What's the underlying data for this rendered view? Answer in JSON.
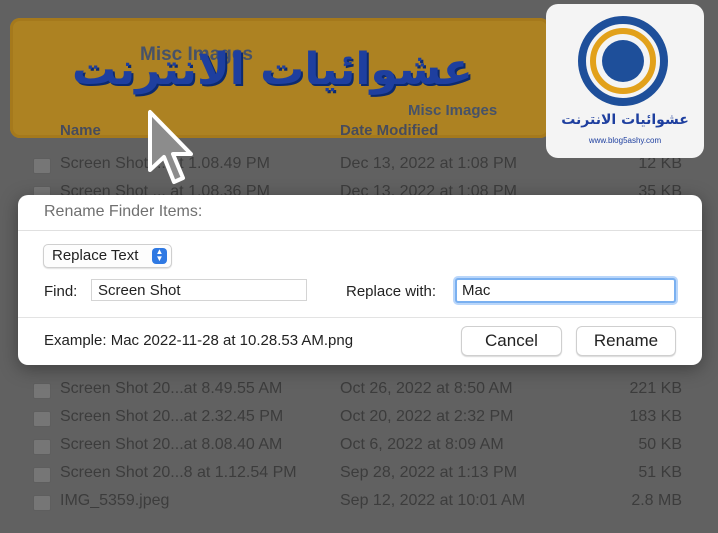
{
  "finder": {
    "folder_title": "Misc Images",
    "folder_subtitle": "Misc Images",
    "columns": {
      "name": "Name",
      "date": "Date Modified"
    },
    "rows_top": [
      {
        "name": "Screen Shot ... at 1.08.49 PM",
        "date": "Dec 13, 2022 at 1:08 PM",
        "size": "12 KB"
      },
      {
        "name": "Screen Shot ... at 1.08.36 PM",
        "date": "Dec 13, 2022 at 1:08 PM",
        "size": "35 KB"
      }
    ],
    "rows_bottom": [
      {
        "name": "Screen Shot 20...at 8.49.55 AM",
        "date": "Oct 26, 2022 at 8:50 AM",
        "size": "221 KB"
      },
      {
        "name": "Screen Shot 20...at 2.32.45 PM",
        "date": "Oct 20, 2022 at 2:32 PM",
        "size": "183 KB"
      },
      {
        "name": "Screen Shot 20...at 8.08.40 AM",
        "date": "Oct 6, 2022 at 8:09 AM",
        "size": "50 KB"
      },
      {
        "name": "Screen Shot 20...8 at 1.12.54 PM",
        "date": "Sep 28, 2022 at 1:13 PM",
        "size": "51 KB"
      },
      {
        "name": "IMG_5359.jpeg",
        "date": "Sep 12, 2022 at 10:01 AM",
        "size": "2.8 MB"
      }
    ]
  },
  "watermark": {
    "text": "عشوائيات الانترنت",
    "logo_text": "عشوائيات الانترنت",
    "logo_url": "www.blog5ashy.com"
  },
  "dialog": {
    "title": "Rename Finder Items:",
    "mode_select": "Replace Text",
    "find_label": "Find:",
    "find_value": "Screen Shot",
    "replace_label": "Replace with:",
    "replace_value": "Mac",
    "example": "Example: Mac 2022-11-28 at 10.28.53 AM.png",
    "cancel_label": "Cancel",
    "rename_label": "Rename"
  },
  "colors": {
    "accent": "#2f79e3",
    "focus_ring": "#7ab0f0",
    "watermark_blue": "#1e3f9f",
    "title_bar_gold": "#d39a1a"
  }
}
